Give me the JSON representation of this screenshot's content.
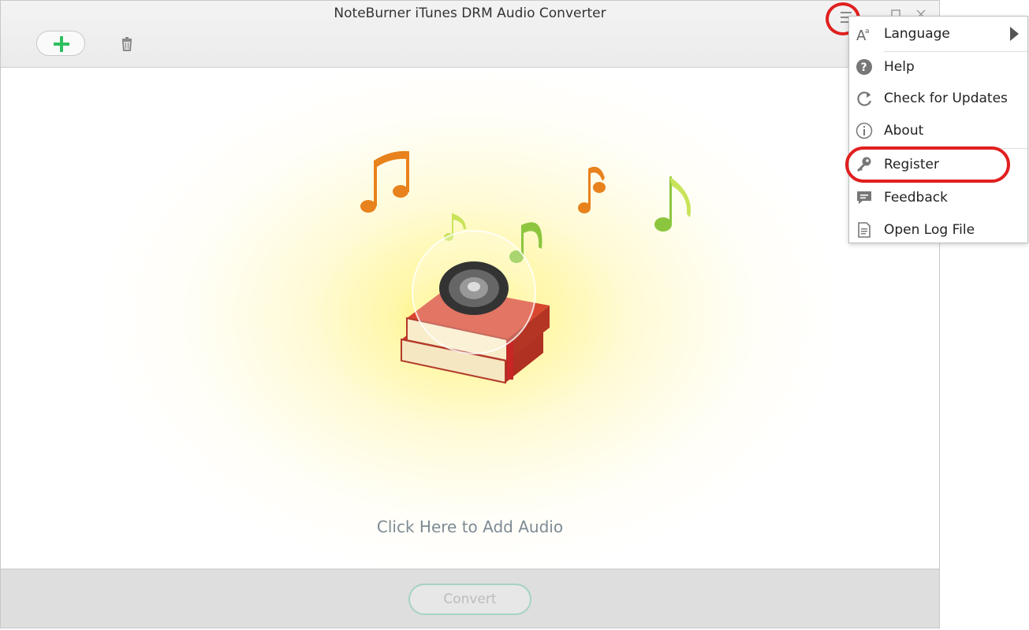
{
  "window": {
    "title": "NoteBurner iTunes DRM Audio Converter"
  },
  "toolbar": {
    "add_icon": "plus-icon",
    "delete_icon": "trash-icon",
    "menu_icon": "hamburger-menu-icon"
  },
  "main": {
    "add_audio_label": "Click Here to Add Audio"
  },
  "footer": {
    "convert_label": "Convert"
  },
  "menu": {
    "items": [
      {
        "label": "Language",
        "icon": "language-icon",
        "has_submenu": true
      },
      {
        "label": "Help",
        "icon": "help-icon"
      },
      {
        "label": "Check for Updates",
        "icon": "refresh-icon"
      },
      {
        "label": "About",
        "icon": "info-icon"
      },
      {
        "label": "Register",
        "icon": "key-icon"
      },
      {
        "label": "Feedback",
        "icon": "feedback-icon"
      },
      {
        "label": "Open Log File",
        "icon": "log-file-icon"
      }
    ]
  },
  "colors": {
    "accent_green": "#2fbf5f",
    "highlight_red": "#e0201f",
    "note_orange": "#e8821c",
    "note_green": "#8cc63f"
  }
}
